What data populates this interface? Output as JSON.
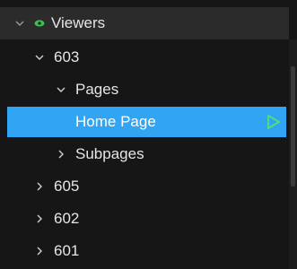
{
  "tree": {
    "root": {
      "label": "Viewers",
      "icon": "eye-icon",
      "expanded": true
    },
    "items": [
      {
        "label": "603",
        "expanded": true
      },
      {
        "label": "Pages",
        "expanded": true
      },
      {
        "label": "Home Page",
        "selected": true,
        "action_icon": "play-icon"
      },
      {
        "label": "Subpages",
        "expanded": false
      },
      {
        "label": "605",
        "expanded": false
      },
      {
        "label": "602",
        "expanded": false
      },
      {
        "label": "601",
        "expanded": false
      }
    ]
  },
  "colors": {
    "background": "#161616",
    "header_bg": "#2b2b2b",
    "selected_bg": "#31a5f3",
    "eye_green": "#3fbf4f",
    "play_green": "#56e36a"
  }
}
